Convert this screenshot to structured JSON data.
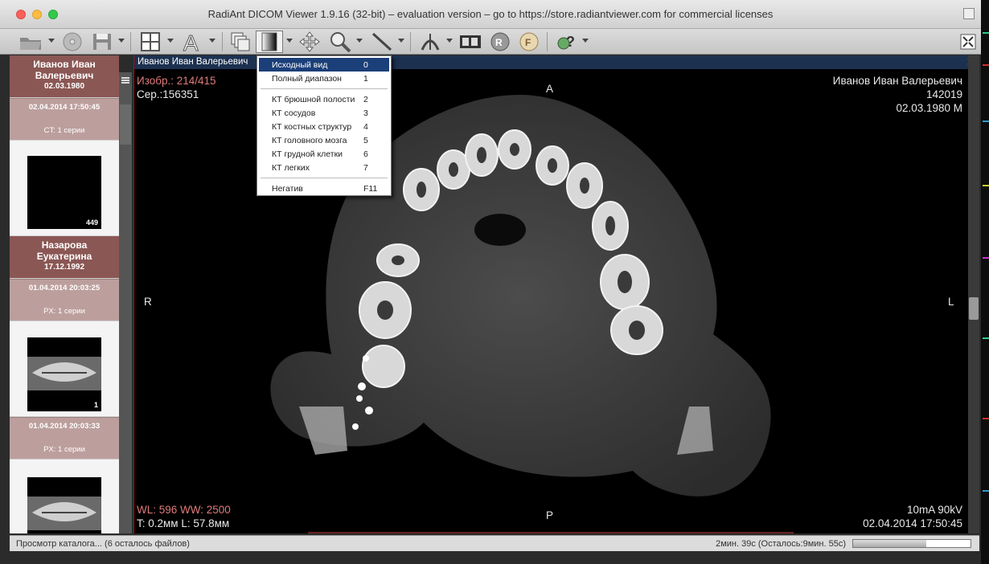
{
  "window": {
    "title": "RadiAnt DICOM Viewer 1.9.16 (32-bit) – evaluation version – go to https://store.radiantviewer.com for commercial licenses"
  },
  "toolbar": {
    "icons": [
      "open-folder-icon",
      "cd-icon",
      "save-icon",
      "layout-icon",
      "text-annotation-icon",
      "series-icon",
      "window-level-icon",
      "pan-icon",
      "zoom-icon",
      "measure-ruler-icon",
      "mpr-icon",
      "cine-icon",
      "mpr-3d-icon",
      "fusion-icon",
      "help-icon"
    ]
  },
  "sidebar": {
    "patients": [
      {
        "name_line1": "Иванов Иван",
        "name_line2": "Валерьевич",
        "dob": "02.03.1980",
        "studies": [
          {
            "date": "02.04.2014 17:50:45",
            "modality": "CT: 1 серии",
            "thumb_count": "449"
          }
        ]
      },
      {
        "name_line1": "Назарова",
        "name_line2": "Еукатерина",
        "dob": "17.12.1992",
        "studies": [
          {
            "date": "01.04.2014 20:03:25",
            "modality": "PX: 1 серии",
            "thumb_count": "1"
          },
          {
            "date": "01.04.2014 20:03:33",
            "modality": "PX: 1 серии",
            "thumb_count": ""
          }
        ]
      }
    ]
  },
  "viewer": {
    "header": "Иванов Иван Валерьевич",
    "overlay": {
      "image_index": "Изобр.: 214/415",
      "series": "Сер.:156351",
      "patient_name": "Иванов Иван Валерьевич",
      "patient_id": "142019",
      "patient_dob_sex": "02.03.1980 M",
      "orient_top": "A",
      "orient_bottom": "P",
      "orient_left": "R",
      "orient_right": "L",
      "wl_ww": "WL: 596 WW: 2500",
      "thickness_location": "T: 0.2мм L: 57.8мм",
      "exposure": "10mA 90kV",
      "acq_datetime": "02.04.2014 17:50:45"
    }
  },
  "window_preset_menu": {
    "items": [
      {
        "label": "Исходный вид",
        "key": "0",
        "selected": true
      },
      {
        "label": "Полный диапазон",
        "key": "1"
      },
      {
        "label": "КТ брюшной полости",
        "key": "2"
      },
      {
        "label": "КТ сосудов",
        "key": "3"
      },
      {
        "label": "КТ костных структур",
        "key": "4"
      },
      {
        "label": "КТ головного мозга",
        "key": "5"
      },
      {
        "label": "КТ грудной клетки",
        "key": "6"
      },
      {
        "label": "КТ легких",
        "key": "7"
      },
      {
        "label": "Негатив",
        "key": "F11"
      }
    ]
  },
  "status": {
    "left": "Просмотр каталога... (6 осталось файлов)",
    "right": "2мин. 39с (Осталось:9мин. 55с)",
    "progress_fraction": 0.62
  },
  "colors": {
    "patient_header": "#8a5754",
    "study_header": "#bc9f9d",
    "menu_selected": "#1b3f78",
    "overlay_red": "#e07a7a"
  }
}
